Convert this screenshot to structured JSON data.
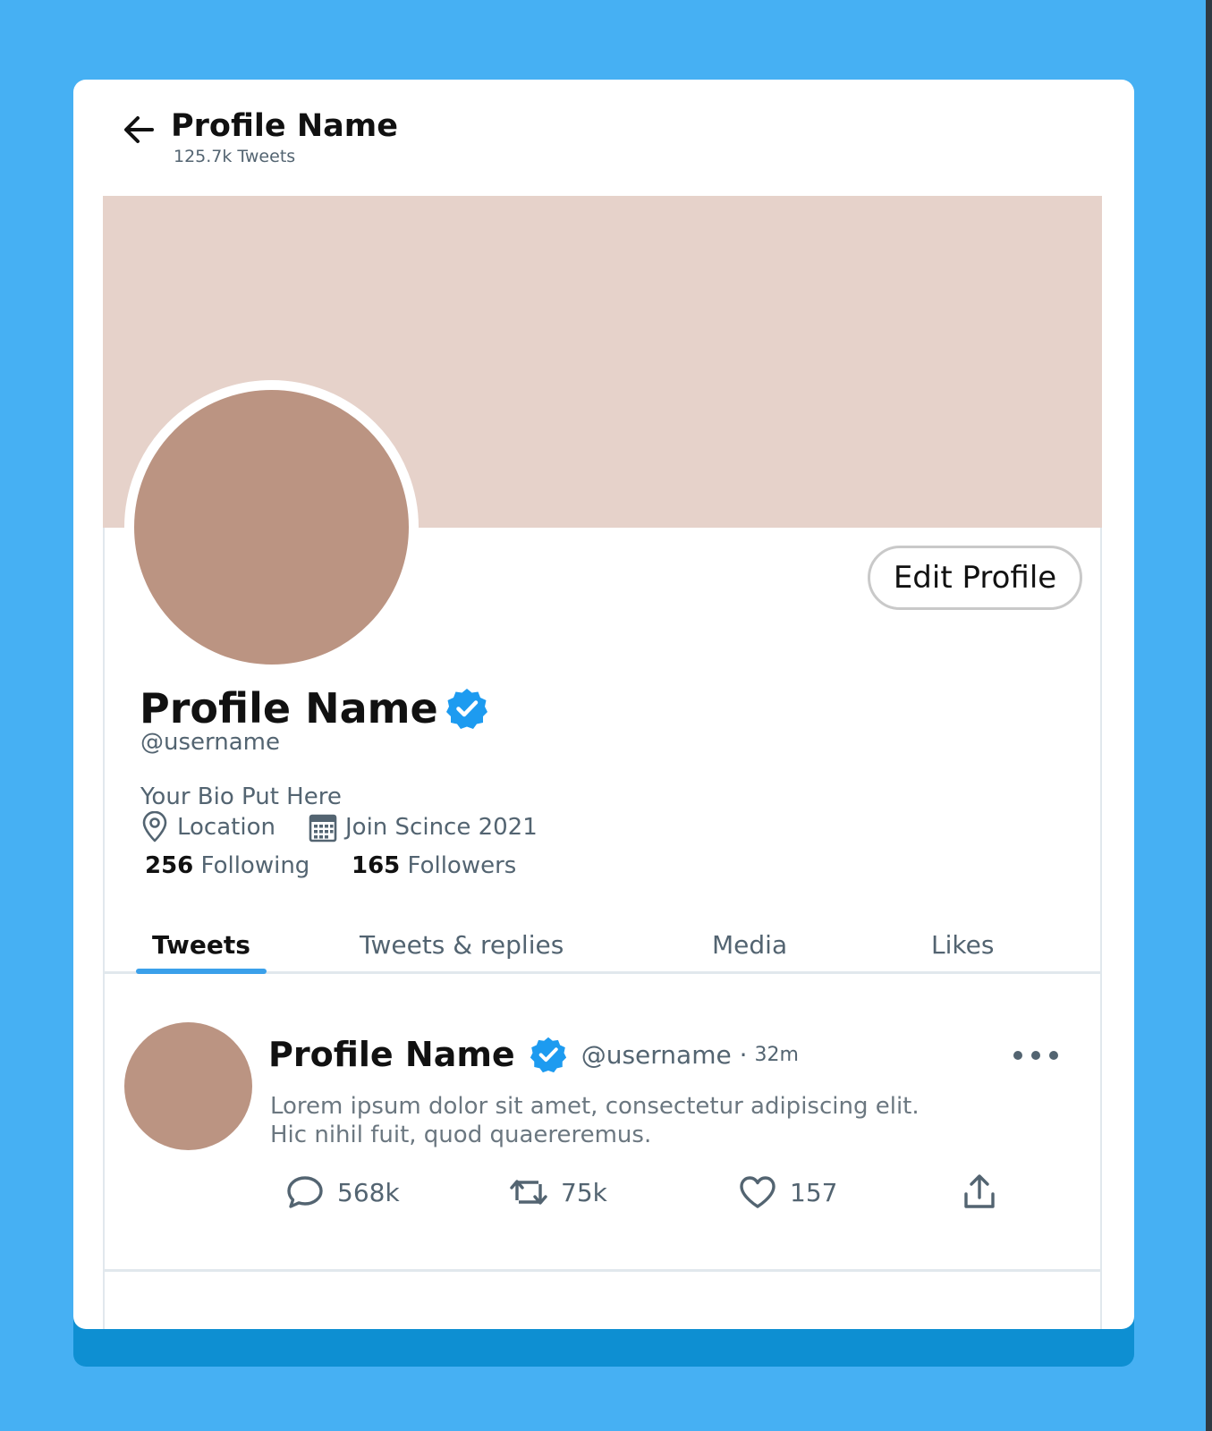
{
  "header": {
    "title": "Profile Name",
    "tweet_count": "125.7k Tweets"
  },
  "profile": {
    "name": "Profile Name",
    "handle": "@username",
    "bio": "Your Bio Put Here",
    "location": "Location",
    "joined": "Join Scince 2021",
    "following_count": "256",
    "following_label": "Following",
    "followers_count": "165",
    "followers_label": "Followers",
    "edit_button_label": "Edit Profile",
    "banner_color": "#e6d2ca",
    "avatar_color": "#bb9482"
  },
  "tabs": [
    {
      "label": "Tweets",
      "active": true
    },
    {
      "label": "Tweets & replies",
      "active": false
    },
    {
      "label": "Media",
      "active": false
    },
    {
      "label": "Likes",
      "active": false
    }
  ],
  "tweet": {
    "name": "Profile Name",
    "handle_time": "@username ·",
    "time": "32m",
    "text_line1": "Lorem ipsum dolor sit amet, consectetur adipiscing elit.",
    "text_line2": "Hic nihil fuit, quod quaereremus.",
    "replies": "568k",
    "retweets": "75k",
    "likes": "157"
  },
  "icons": {
    "back": "arrow-left",
    "verified": "verified-badge",
    "location": "map-pin",
    "calendar": "calendar",
    "more": "more-horizontal",
    "reply": "speech-bubble",
    "retweet": "retweet-arrows",
    "like": "heart",
    "share": "share-upload"
  },
  "colors": {
    "page_background": "#46b0f3",
    "accent": "#1d9bf0",
    "tab_indicator": "#3aa0ea"
  }
}
